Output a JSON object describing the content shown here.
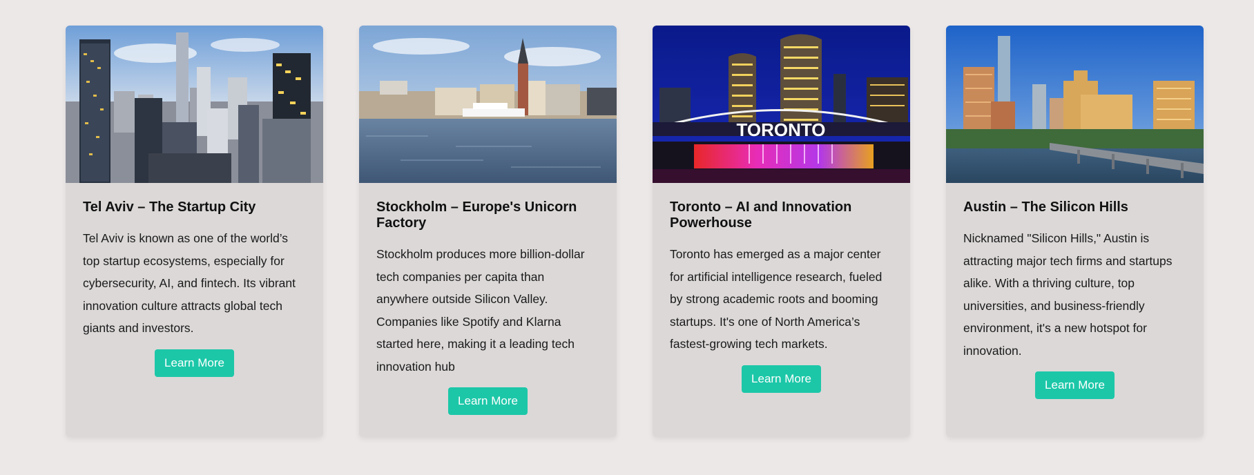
{
  "cards": [
    {
      "image": "tel-aviv-skyline-image",
      "title": "Tel Aviv – The Startup City",
      "text": "Tel Aviv is known as one of the world’s top startup ecosystems, especially for cybersecurity, AI, and fintech. Its vibrant innovation culture attracts global tech giants and investors.",
      "button": "Learn More"
    },
    {
      "image": "stockholm-waterfront-image",
      "title": "Stockholm – Europe's Unicorn Factory",
      "text": "Stockholm produces more billion-dollar tech companies per capita than anywhere outside Silicon Valley. Companies like Spotify and Klarna started here, making it a leading tech innovation hub",
      "button": "Learn More"
    },
    {
      "image": "toronto-night-sign-image",
      "image_sign": "TORONTO",
      "title": "Toronto – AI and Innovation Powerhouse",
      "text": "Toronto has emerged as a major center for artificial intelligence research, fueled by strong academic roots and booming startups. It's one of North America’s fastest-growing tech markets.",
      "button": "Learn More"
    },
    {
      "image": "austin-skyline-image",
      "title": "Austin – The Silicon Hills",
      "text": "Nicknamed \"Silicon Hills,\" Austin is attracting major tech firms and startups alike. With a thriving culture, top universities, and business-friendly environment, it's a new hotspot for innovation.",
      "button": "Learn More"
    }
  ],
  "colors": {
    "background": "#ece8e8",
    "card": "#dcd8d8",
    "button": "#1cc7a8",
    "button_text": "#ffffff"
  }
}
